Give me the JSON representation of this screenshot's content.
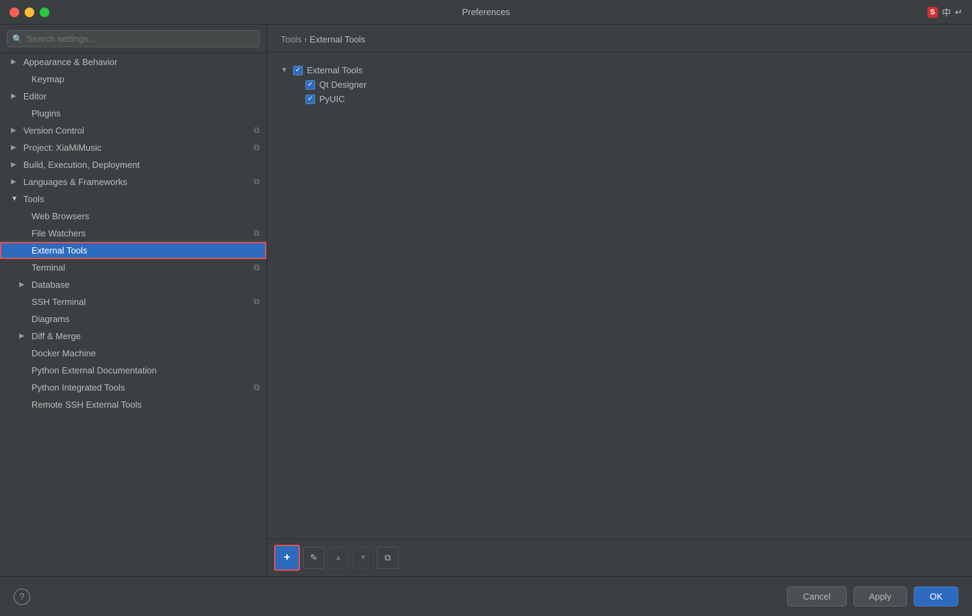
{
  "titleBar": {
    "title": "Preferences",
    "buttons": {
      "close": "close",
      "minimize": "minimize",
      "maximize": "maximize"
    }
  },
  "search": {
    "placeholder": "Search settings..."
  },
  "sidebar": {
    "items": [
      {
        "id": "appearance",
        "label": "Appearance & Behavior",
        "indent": 0,
        "arrow": "▶",
        "hasBadge": false
      },
      {
        "id": "keymap",
        "label": "Keymap",
        "indent": 1,
        "arrow": "",
        "hasBadge": false
      },
      {
        "id": "editor",
        "label": "Editor",
        "indent": 0,
        "arrow": "▶",
        "hasBadge": false
      },
      {
        "id": "plugins",
        "label": "Plugins",
        "indent": 1,
        "arrow": "",
        "hasBadge": false
      },
      {
        "id": "version-control",
        "label": "Version Control",
        "indent": 0,
        "arrow": "▶",
        "hasBadge": true
      },
      {
        "id": "project",
        "label": "Project: XiaMiMusic",
        "indent": 0,
        "arrow": "▶",
        "hasBadge": true
      },
      {
        "id": "build",
        "label": "Build, Execution, Deployment",
        "indent": 0,
        "arrow": "▶",
        "hasBadge": false
      },
      {
        "id": "languages",
        "label": "Languages & Frameworks",
        "indent": 0,
        "arrow": "▶",
        "hasBadge": true
      },
      {
        "id": "tools",
        "label": "Tools",
        "indent": 0,
        "arrow": "▼",
        "hasBadge": false
      },
      {
        "id": "web-browsers",
        "label": "Web Browsers",
        "indent": 1,
        "arrow": "",
        "hasBadge": false
      },
      {
        "id": "file-watchers",
        "label": "File Watchers",
        "indent": 1,
        "arrow": "",
        "hasBadge": true
      },
      {
        "id": "external-tools",
        "label": "External Tools",
        "indent": 1,
        "arrow": "",
        "hasBadge": false,
        "selected": true
      },
      {
        "id": "terminal",
        "label": "Terminal",
        "indent": 1,
        "arrow": "",
        "hasBadge": true
      },
      {
        "id": "database",
        "label": "Database",
        "indent": 1,
        "arrow": "▶",
        "hasBadge": false
      },
      {
        "id": "ssh-terminal",
        "label": "SSH Terminal",
        "indent": 1,
        "arrow": "",
        "hasBadge": true
      },
      {
        "id": "diagrams",
        "label": "Diagrams",
        "indent": 1,
        "arrow": "",
        "hasBadge": false
      },
      {
        "id": "diff-merge",
        "label": "Diff & Merge",
        "indent": 1,
        "arrow": "▶",
        "hasBadge": false
      },
      {
        "id": "docker-machine",
        "label": "Docker Machine",
        "indent": 1,
        "arrow": "",
        "hasBadge": false
      },
      {
        "id": "python-ext-docs",
        "label": "Python External Documentation",
        "indent": 1,
        "arrow": "",
        "hasBadge": false
      },
      {
        "id": "python-int-tools",
        "label": "Python Integrated Tools",
        "indent": 1,
        "arrow": "",
        "hasBadge": true
      },
      {
        "id": "remote-ssh",
        "label": "Remote SSH External Tools",
        "indent": 1,
        "arrow": "",
        "hasBadge": false
      }
    ]
  },
  "breadcrumb": {
    "parent": "Tools",
    "separator": "›",
    "current": "External Tools"
  },
  "contentTree": {
    "nodes": [
      {
        "id": "external-tools-root",
        "label": "External Tools",
        "indent": 0,
        "arrow": "▼",
        "checked": true
      },
      {
        "id": "qt-designer",
        "label": "Qt Designer",
        "indent": 1,
        "arrow": "",
        "checked": true
      },
      {
        "id": "pyuic",
        "label": "PyUIC",
        "indent": 1,
        "arrow": "",
        "checked": true
      }
    ]
  },
  "toolbar": {
    "add_label": "+",
    "edit_label": "✎",
    "up_label": "▲",
    "down_label": "▼",
    "copy_label": "⧉"
  },
  "bottomBar": {
    "help_label": "?",
    "cancel_label": "Cancel",
    "apply_label": "Apply",
    "ok_label": "OK"
  }
}
